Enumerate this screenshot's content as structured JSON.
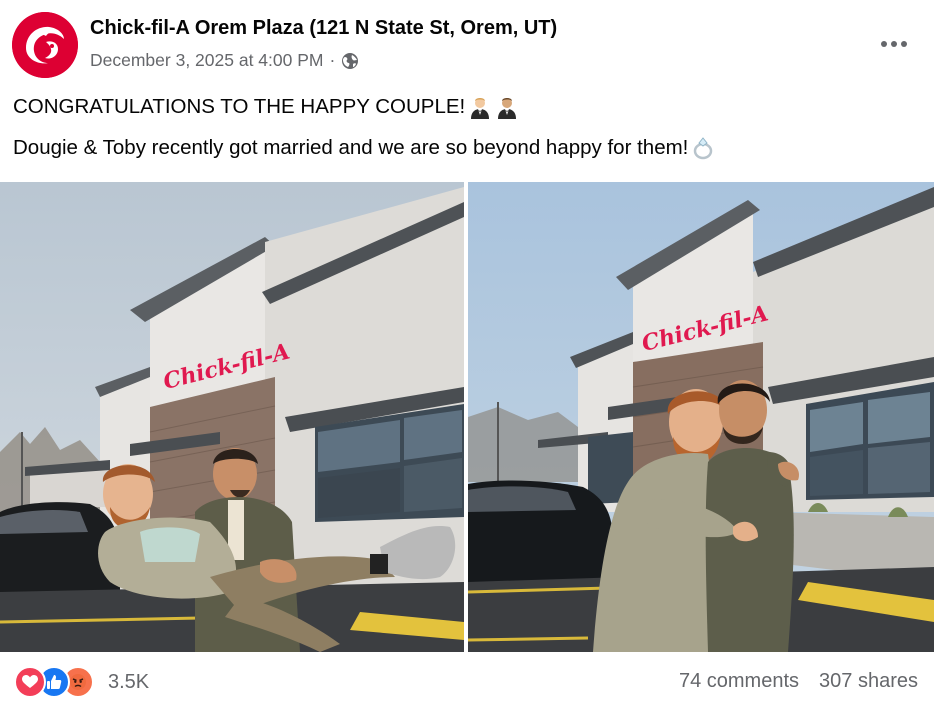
{
  "post": {
    "page_name": "Chick-fil-A Orem Plaza (121 N State St, Orem, UT)",
    "timestamp": "December 3, 2025 at 4:00 PM",
    "separator": "·",
    "audience_icon": "globe-icon",
    "line1": "CONGRATULATIONS TO THE HAPPY COUPLE!",
    "line2": "Dougie & Toby recently got married and we are so beyond happy for them!",
    "line1_emojis": [
      "man-in-tuxedo-emoji",
      "man-in-tuxedo-emoji"
    ],
    "line2_emoji": "ring-emoji",
    "photos": [
      {
        "name": "photo-couple-carry",
        "sign_text": "Chick-fil-A"
      },
      {
        "name": "photo-couple-hug",
        "sign_text": "Chick-fil-A"
      }
    ]
  },
  "footer": {
    "reaction_icons": [
      "love-icon",
      "like-icon",
      "angry-icon"
    ],
    "reaction_count": "3.5K",
    "comments": "74 comments",
    "shares": "307 shares"
  },
  "colors": {
    "brand_red": "#dd0033",
    "meta_gray": "#65676b",
    "like_blue": "#1877f2",
    "love_red": "#f33e58",
    "angry_orange": "#f7714c"
  }
}
